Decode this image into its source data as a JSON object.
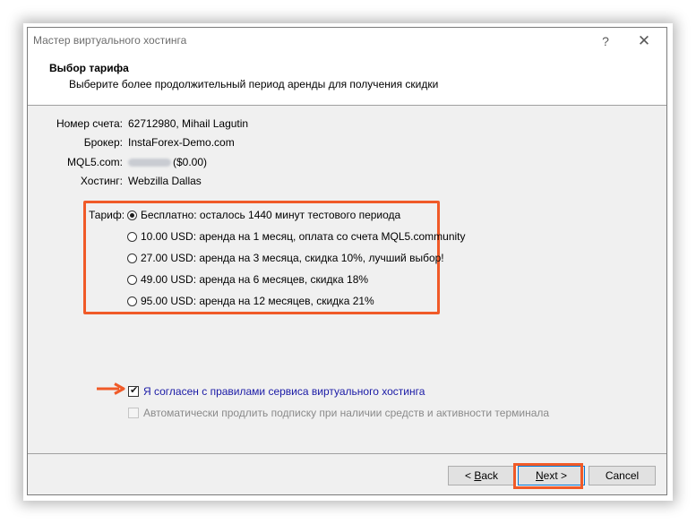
{
  "window": {
    "title": "Мастер виртуального хостинга",
    "help_glyph": "?",
    "close_glyph": "✕"
  },
  "header": {
    "title": "Выбор тарифа",
    "subtitle": "Выберите более продолжительный период аренды для получения скидки"
  },
  "account": {
    "number_label": "Номер счета:",
    "number_value": "62712980, Mihail Lagutin",
    "broker_label": "Брокер:",
    "broker_value": "InstaForex-Demo.com",
    "mql5_label": "MQL5.com:",
    "mql5_value": "($0.00)",
    "hosting_label": "Хостинг:",
    "hosting_value": "Webzilla Dallas"
  },
  "tariff": {
    "label": "Тариф:",
    "options": [
      {
        "text": "Бесплатно: осталось 1440 минут тестового периода",
        "selected": true
      },
      {
        "text": "10.00 USD: аренда на 1 месяц, оплата со счета MQL5.community",
        "selected": false
      },
      {
        "text": "27.00 USD: аренда на 3 месяца, скидка 10%, лучший выбор!",
        "selected": false
      },
      {
        "text": "49.00 USD: аренда на 6 месяцев, скидка 18%",
        "selected": false
      },
      {
        "text": "95.00 USD: аренда на 12 месяцев, скидка 21%",
        "selected": false
      }
    ]
  },
  "agreement": {
    "agree_text": "Я согласен с правилами сервиса виртуального хостинга",
    "agree_checked": true,
    "renew_text": "Автоматически продлить подписку при наличии средств и активности терминала",
    "renew_enabled": false
  },
  "buttons": {
    "back_prefix": "< ",
    "back_underlined": "B",
    "back_rest": "ack",
    "next_underlined": "N",
    "next_rest": "ext >",
    "cancel": "Cancel"
  },
  "colors": {
    "highlight": "#f05a28",
    "agree_text": "#1a1aa6",
    "disabled_text": "#8a8a8a"
  }
}
